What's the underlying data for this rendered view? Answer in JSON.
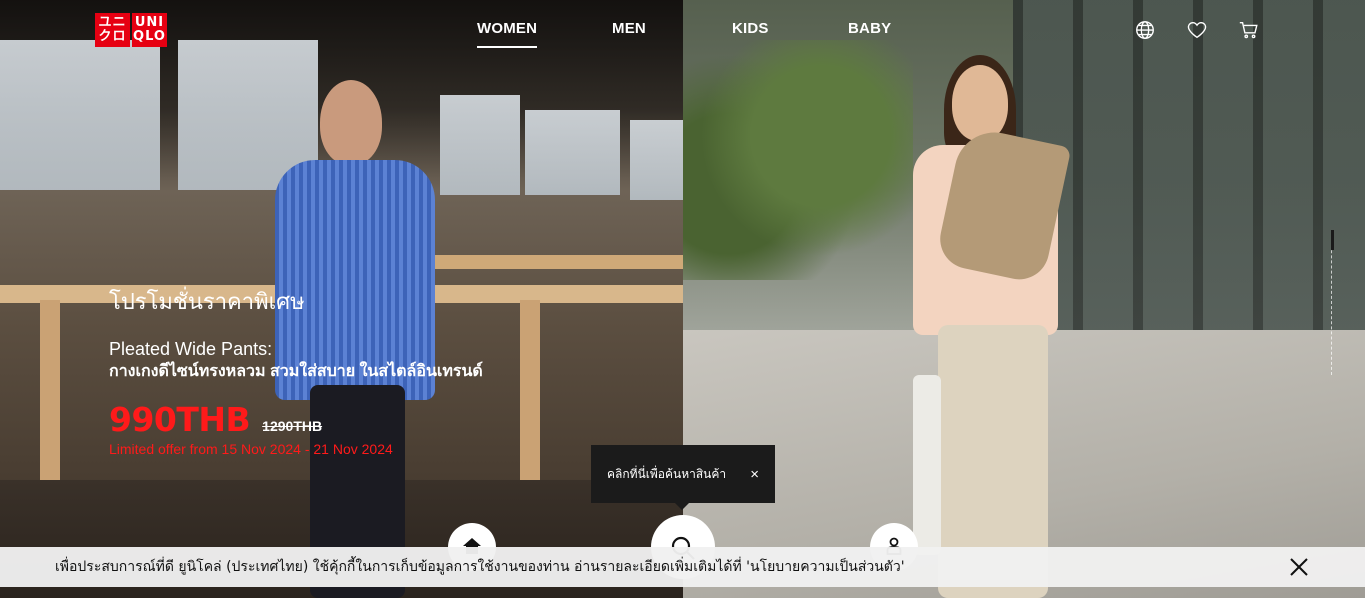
{
  "brand": {
    "logo_left": "ユニ\nクロ",
    "logo_right": "UNI\nQLO",
    "accent": "#e60012"
  },
  "nav": {
    "items": [
      {
        "label": "WOMEN",
        "active": true
      },
      {
        "label": "MEN",
        "active": false
      },
      {
        "label": "KIDS",
        "active": false
      },
      {
        "label": "BABY",
        "active": false
      }
    ]
  },
  "header_icons": [
    "globe-icon",
    "heart-icon",
    "cart-icon"
  ],
  "promo": {
    "title": "โปรโมชั่นราคาพิเศษ",
    "subtitle_line1": "Pleated Wide Pants:",
    "subtitle_line2": "กางเกงดีไซน์ทรงหลวม สวมใส่สบาย ในสไตล์อินเทรนด์",
    "price": "990THB",
    "old_price": "1290THB",
    "offer": "Limited offer from 15 Nov 2024 - 21 Nov 2024",
    "price_color": "#ff1a1a"
  },
  "tooltip": {
    "text": "คลิกที่นี่เพื่อค้นหาสินค้า",
    "close": "×"
  },
  "bottom_nav": [
    "home-icon",
    "search-icon",
    "account-icon"
  ],
  "cookie": {
    "text": "เพื่อประสบการณ์ที่ดี ยูนิโคล่ (ประเทศไทย) ใช้คุ้กกี้ในการเก็บข้อมูลการใช้งานของท่าน อ่านรายละเอียดเพิ่มเติมได้ที่ 'นโยบายความเป็นส่วนตัว'"
  }
}
